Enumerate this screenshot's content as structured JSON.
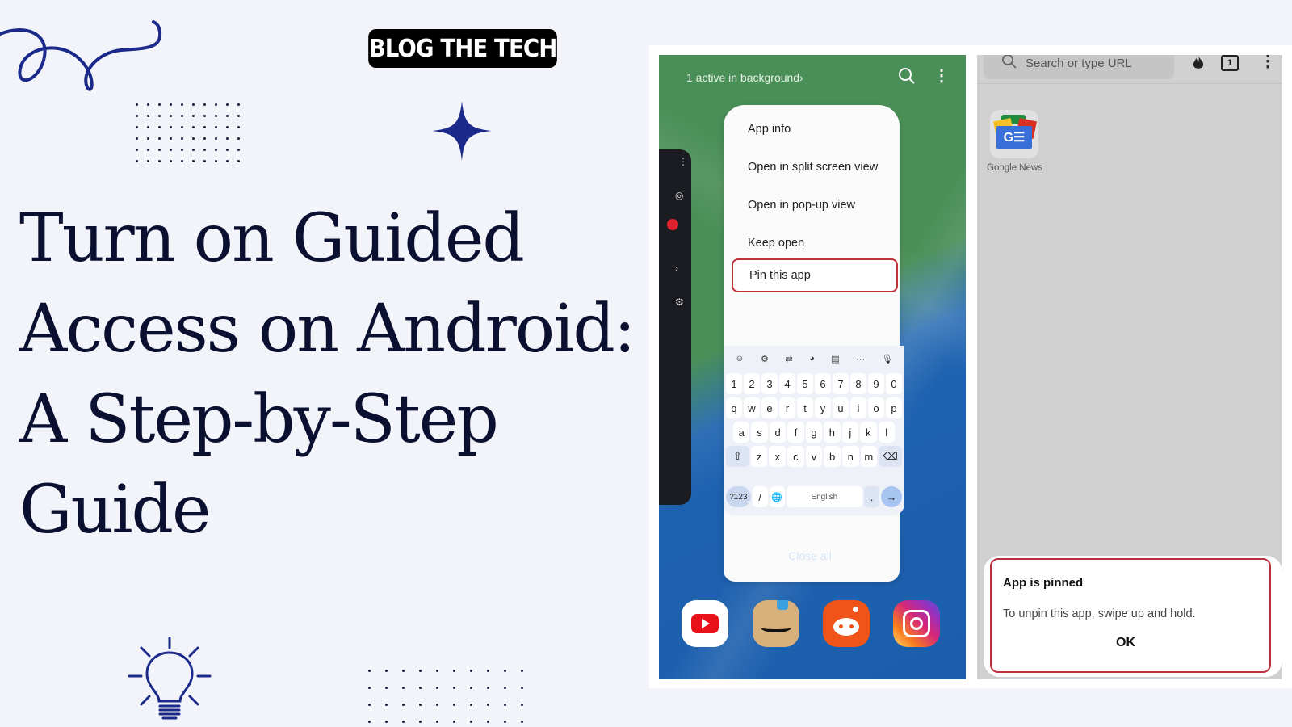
{
  "brand": {
    "label": "BLOG THE TECH"
  },
  "title": {
    "lines": [
      "Turn on Guided",
      "Access on Android:",
      "A Step-by-Step",
      "Guide"
    ]
  },
  "colors": {
    "background": "#f2f4fa",
    "title": "#0b1030",
    "accent_navy": "#1b2a8a",
    "highlight_red": "#c0313a",
    "recents_green": "#4a8f58",
    "recents_blue": "#1d62b0"
  },
  "decor": {
    "squiggle_icon": "squiggle-icon",
    "sparkle_icon": "four-point-star-icon",
    "bulb_icon": "lightbulb-icon",
    "dots_top": {
      "cols": 10,
      "rows": 6
    },
    "dots_bottom": {
      "cols": 10,
      "rows": 4
    }
  },
  "phone1": {
    "header": {
      "background_label": "1 active in background",
      "chevron": "›",
      "search_icon": "search-icon",
      "more_icon": "more-vertical-icon"
    },
    "menu": {
      "items": [
        "App info",
        "Open in split screen view",
        "Open in pop-up view",
        "Keep open",
        "Pin this app"
      ],
      "highlighted": "Pin this app"
    },
    "keyboard": {
      "toolbar": [
        "emoji-face-icon",
        "gear-icon",
        "translate-icon",
        "palette-icon",
        "clipboard-icon",
        "more-horizontal-icon",
        "mic-off-icon"
      ],
      "toolbar_glyphs": [
        "☺",
        "⚙",
        "⇄",
        "◕",
        "▤",
        "⋯",
        "🎙"
      ],
      "rows": [
        [
          "1",
          "2",
          "3",
          "4",
          "5",
          "6",
          "7",
          "8",
          "9",
          "0"
        ],
        [
          "q",
          "w",
          "e",
          "r",
          "t",
          "y",
          "u",
          "i",
          "o",
          "p"
        ],
        [
          "a",
          "s",
          "d",
          "f",
          "g",
          "h",
          "j",
          "k",
          "l"
        ],
        [
          "⇧",
          "z",
          "x",
          "c",
          "v",
          "b",
          "n",
          "m",
          "⌫"
        ]
      ],
      "bottom_row": {
        "symbols": "?123",
        "slash": "/",
        "globe": "🌐",
        "space": "English",
        "period": ".",
        "enter": "→"
      }
    },
    "close_all_label": "Close all",
    "dock": [
      "youtube-icon",
      "amazon-icon",
      "reddit-icon",
      "instagram-icon"
    ]
  },
  "phone2": {
    "search_placeholder": "Search or type URL",
    "tab_count": "1",
    "shortcut_label": "Google News",
    "dialog": {
      "title": "App is pinned",
      "body": "To unpin this app, swipe up and hold.",
      "ok_label": "OK"
    }
  }
}
